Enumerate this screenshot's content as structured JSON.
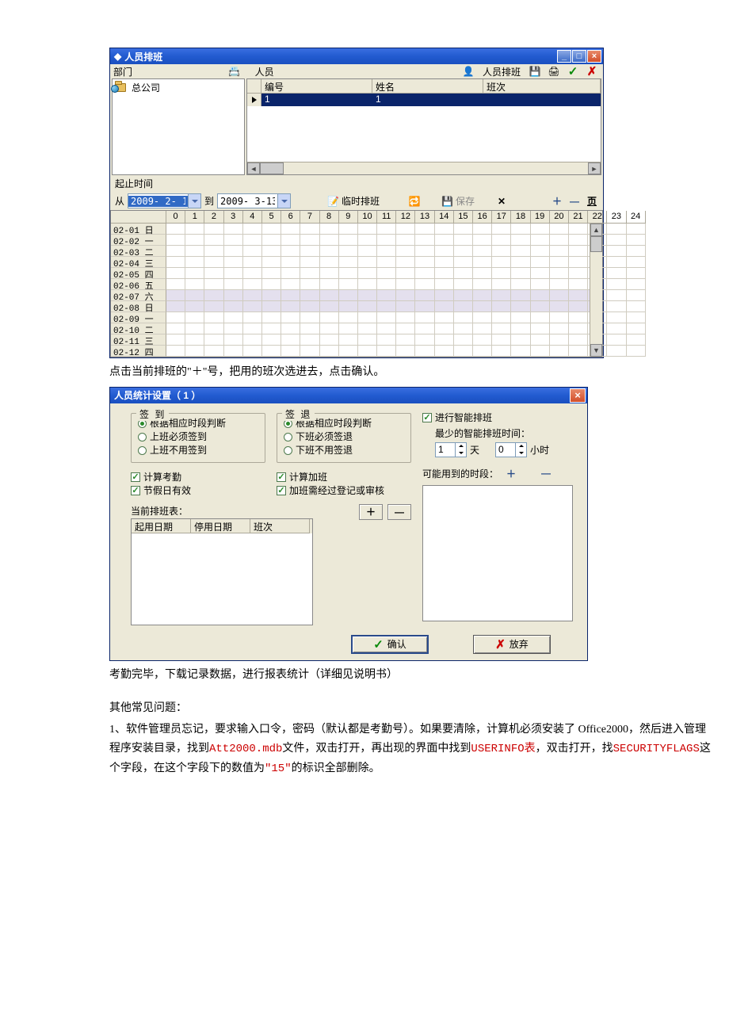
{
  "window1": {
    "title": "人员排班",
    "dept_label": "部门",
    "person_label": "人员",
    "schedule_btn": "人员排班",
    "dept_root": "总公司",
    "columns": {
      "id": "编号",
      "name": "姓名",
      "shift": "班次"
    },
    "data_row": {
      "id": "1",
      "name": "1"
    },
    "range": {
      "label": "起止时间",
      "from": "从",
      "to": "到",
      "date_from": "2009- 2- 1",
      "date_to": "2009- 3-13"
    },
    "temp_btn": "临时排班",
    "save_btn": "保存",
    "schedule_rows": [
      {
        "d": "02-01",
        "w": "日",
        "alt": false
      },
      {
        "d": "02-02",
        "w": "一",
        "alt": false
      },
      {
        "d": "02-03",
        "w": "二",
        "alt": false
      },
      {
        "d": "02-04",
        "w": "三",
        "alt": false
      },
      {
        "d": "02-05",
        "w": "四",
        "alt": false
      },
      {
        "d": "02-06",
        "w": "五",
        "alt": false
      },
      {
        "d": "02-07",
        "w": "六",
        "alt": true
      },
      {
        "d": "02-08",
        "w": "日",
        "alt": true
      },
      {
        "d": "02-09",
        "w": "一",
        "alt": false
      },
      {
        "d": "02-10",
        "w": "二",
        "alt": false
      },
      {
        "d": "02-11",
        "w": "三",
        "alt": false
      },
      {
        "d": "02-12",
        "w": "四",
        "alt": false
      }
    ],
    "hours": [
      "0",
      "1",
      "2",
      "3",
      "4",
      "5",
      "6",
      "7",
      "8",
      "9",
      "10",
      "11",
      "12",
      "13",
      "14",
      "15",
      "16",
      "17",
      "18",
      "19",
      "20",
      "21",
      "22",
      "23",
      "24"
    ]
  },
  "para1": "点击当前排班的\"＋\"号，把用的班次选进去，点击确认。",
  "window2": {
    "title": "人员统计设置（ 1 ）",
    "signin": {
      "legend": "签  到",
      "r1": "根据相应时段判断",
      "r2": "上班必须签到",
      "r3": "上班不用签到"
    },
    "signout": {
      "legend": "签  退",
      "r1": "根据相应时段判断",
      "r2": "下班必须签退",
      "r3": "下班不用签退"
    },
    "calc_att": "计算考勤",
    "holiday": "节假日有效",
    "calc_ot": "计算加班",
    "ot_reg": "加班需经过登记或审核",
    "smart": "进行智能排班",
    "smart_time": "最少的智能排班时间：",
    "days": "1",
    "days_unit": "天",
    "hours": "0",
    "hours_unit": "小时",
    "possible": "可能用到的时段：",
    "cur_table": "当前排班表：",
    "cols": {
      "start": "起用日期",
      "stop": "停用日期",
      "shift": "班次"
    },
    "ok": "确认",
    "cancel": "放弃"
  },
  "para2": "考勤完毕，下载记录数据，进行报表统计（详细见说明书）",
  "faq_title": "其他常见问题：",
  "faq1_a": "1、软件管理员忘记，要求输入口令，密码（默认都是考勤号）。如果要清除，计算机必须安装了 Office2000，然后进入管理程序安装目录，找到",
  "faq1_file": "Att2000.mdb",
  "faq1_b": "文件，双击打开，再出现的界面中找到",
  "faq1_tbl": "USERINFO表",
  "faq1_c": "，双击打开，找",
  "faq1_fld": "SECURITYFLAGS",
  "faq1_d": "这个字段，在这个字段下的数值为",
  "faq1_val": "\"15\"",
  "faq1_e": "的标识全部删除。"
}
